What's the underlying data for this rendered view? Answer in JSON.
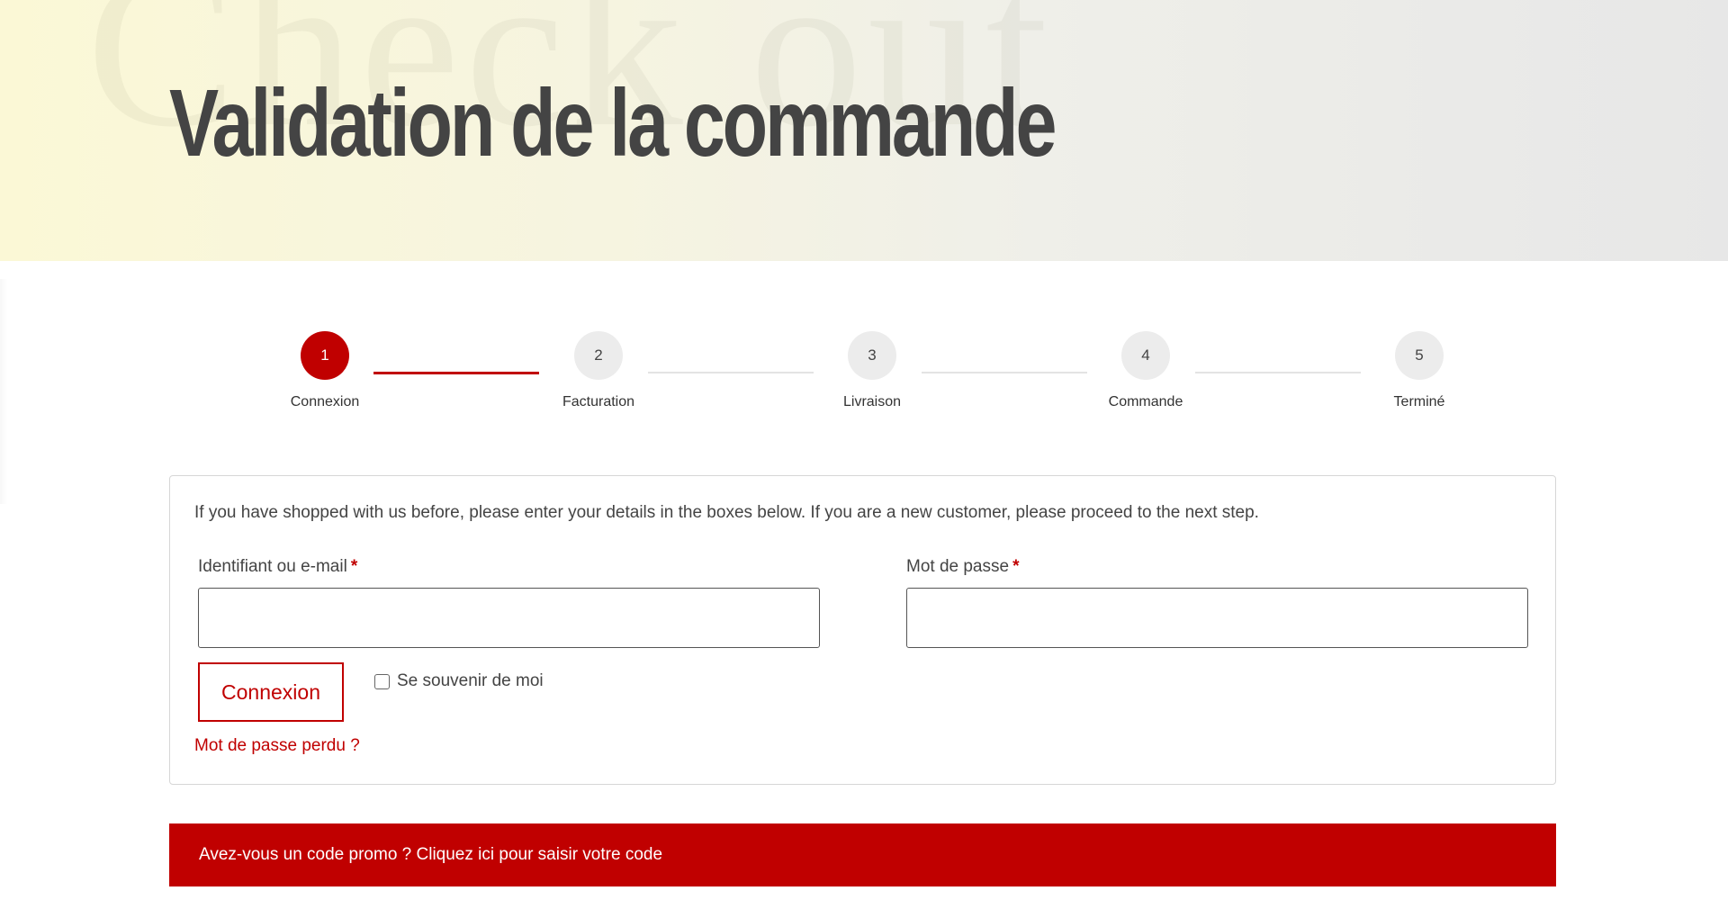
{
  "hero": {
    "background_word": "Check out",
    "title": "Validation de la commande"
  },
  "steps": [
    {
      "number": "1",
      "label": "Connexion",
      "active": true
    },
    {
      "number": "2",
      "label": "Facturation",
      "active": false
    },
    {
      "number": "3",
      "label": "Livraison",
      "active": false
    },
    {
      "number": "4",
      "label": "Commande",
      "active": false
    },
    {
      "number": "5",
      "label": "Terminé",
      "active": false
    }
  ],
  "login": {
    "intro": "If you have shopped with us before, please enter your details in the boxes below. If you are a new customer, please proceed to the next step.",
    "username_label": "Identifiant ou e-mail",
    "password_label": "Mot de passe",
    "required_marker": "*",
    "username_value": "",
    "password_value": "",
    "submit_label": "Connexion",
    "remember_label": "Se souvenir de moi",
    "remember_checked": false,
    "lost_password_label": "Mot de passe perdu ?"
  },
  "promo": {
    "text": "Avez-vous un code promo ? Cliquez ici pour saisir votre code"
  },
  "colors": {
    "accent": "#c00000",
    "step_inactive": "#ececec",
    "title": "#444444"
  }
}
